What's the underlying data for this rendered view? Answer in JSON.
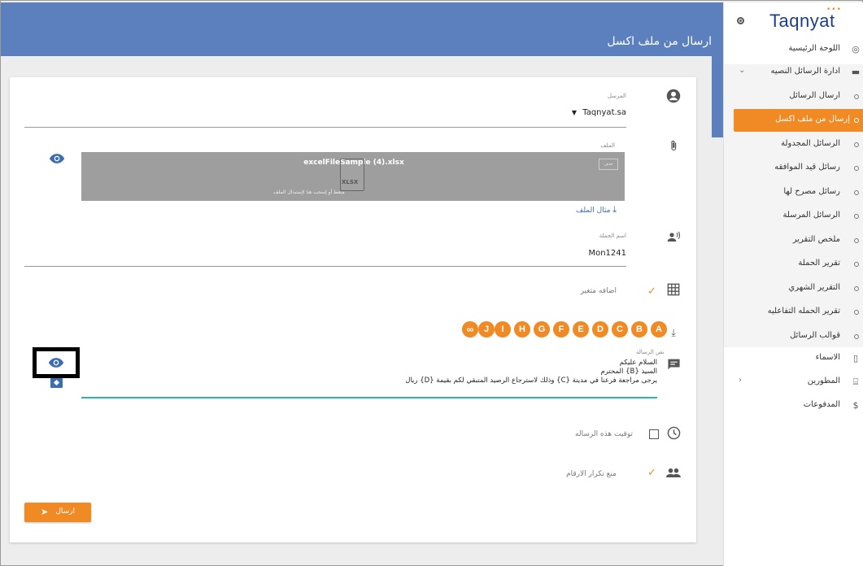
{
  "page": {
    "title": "ارسال من ملف اكسل"
  },
  "sidebar": {
    "logo": "Taqnyat",
    "logo_dots": "•••",
    "items": [
      {
        "label": "اللوحة الرئيسية",
        "icon": "palette-icon"
      },
      {
        "label": "ادارة الرسائل النصيه",
        "icon": "message-icon"
      },
      {
        "label": "ارسال الرسائل"
      },
      {
        "label": "إرسال من ملف اكسل"
      },
      {
        "label": "الرسائل المجدولة"
      },
      {
        "label": "رسائل قيد الموافقه"
      },
      {
        "label": "رسائل مصرح لها"
      },
      {
        "label": "الرسائل المرسلة"
      },
      {
        "label": "ملخص التقرير"
      },
      {
        "label": "تقرير الحملة"
      },
      {
        "label": "التقرير الشهري"
      },
      {
        "label": "تقرير الحمله التفاعليه"
      },
      {
        "label": "قوالب الرسائل"
      },
      {
        "label": "الاسماء",
        "icon": "book-icon"
      },
      {
        "label": "المطورين",
        "icon": "code-icon"
      },
      {
        "label": "المدفوعات",
        "icon": "dollar-icon"
      }
    ]
  },
  "form": {
    "sender_label": "المرسل",
    "sender_value": "Taqnyat.sa",
    "file_label": "الملف",
    "file_name": "excelFileSample (4).xlsx",
    "file_hint": "ضغط أو إسحب هنا لإستبدال الملف",
    "file_ext": "XLSX",
    "file_delete": "حذف",
    "example_link": "مثال الملف",
    "campaign_label": "اسم الحملة",
    "campaign_value": "Mon1241",
    "add_variable": "اضافه متغير",
    "variables": [
      "A",
      "B",
      "C",
      "D",
      "E",
      "F",
      "G",
      "H",
      "I",
      "J",
      "∞"
    ],
    "message_label": "نص الرسالة",
    "message_lines": [
      "السلام عليكم",
      "السيد {B} المحترم",
      "يرجى مراجعة فرعنا في مدينة {C} وذلك لاسترجاع الرصيد المتبقي لكم بقيمة {D} ريال"
    ],
    "schedule_label": "توقيت هذه الرساله",
    "dedupe_label": "منع تكرار الارقام",
    "send_label": "ارسال"
  }
}
